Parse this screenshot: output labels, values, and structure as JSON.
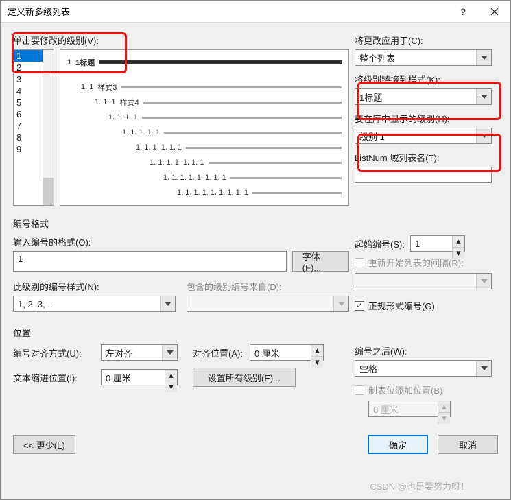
{
  "titlebar": {
    "title": "定义新多级列表"
  },
  "top": {
    "clickLevelLabel": "单击要修改的级别(V):",
    "levels": [
      "1",
      "2",
      "3",
      "4",
      "5",
      "6",
      "7",
      "8",
      "9"
    ],
    "selectedLevel": "1",
    "preview": [
      {
        "num": "1",
        "text": "1标题",
        "indent": 0,
        "bold": true,
        "thin": false
      },
      {
        "num": "1. 1",
        "text": "样式3",
        "indent": 20,
        "bold": false,
        "thin": true
      },
      {
        "num": "1. 1. 1",
        "text": "样式4",
        "indent": 40,
        "bold": false,
        "thin": true
      },
      {
        "num": "1. 1. 1. 1",
        "text": "",
        "indent": 60,
        "bold": false,
        "thin": true
      },
      {
        "num": "1. 1. 1. 1. 1",
        "text": "",
        "indent": 80,
        "bold": false,
        "thin": true
      },
      {
        "num": "1. 1. 1. 1. 1. 1",
        "text": "",
        "indent": 100,
        "bold": false,
        "thin": true
      },
      {
        "num": "1. 1. 1. 1. 1. 1. 1",
        "text": "",
        "indent": 120,
        "bold": false,
        "thin": true
      },
      {
        "num": "1. 1. 1. 1. 1. 1. 1. 1",
        "text": "",
        "indent": 140,
        "bold": false,
        "thin": true
      },
      {
        "num": "1. 1. 1. 1. 1. 1. 1. 1. 1",
        "text": "",
        "indent": 160,
        "bold": false,
        "thin": true
      }
    ]
  },
  "right": {
    "applyToLabel": "将更改应用于(C):",
    "applyToValue": "整个列表",
    "linkStyleLabel": "将级别链接到样式(K):",
    "linkStyleValue": "1标题",
    "showInGalleryLabel": "要在库中显示的级别(H):",
    "showInGalleryValue": "级别 1",
    "listNumLabel": "ListNum 域列表名(T):",
    "listNumValue": ""
  },
  "numberFormat": {
    "section": "编号格式",
    "enterFormatLabel": "输入编号的格式(O):",
    "enterFormatValue": "1",
    "fontBtn": "字体(F)...",
    "styleLabel": "此级别的编号样式(N):",
    "styleValue": "1, 2, 3, ...",
    "includeFromLabel": "包含的级别编号来自(D):",
    "includeFromValue": "",
    "startAtLabel": "起始编号(S):",
    "startAtValue": "1",
    "restartLabel": "重新开始列表的间隔(R):",
    "restartValue": "",
    "legalLabel": "正规形式编号(G)"
  },
  "position": {
    "section": "位置",
    "alignLabel": "编号对齐方式(U):",
    "alignValue": "左对齐",
    "alignAtLabel": "对齐位置(A):",
    "alignAtValue": "0 厘米",
    "indentLabel": "文本缩进位置(I):",
    "indentValue": "0 厘米",
    "setAllBtn": "设置所有级别(E)...",
    "followLabel": "编号之后(W):",
    "followValue": "空格",
    "tabAddLabel": "制表位添加位置(B):",
    "tabAddValue": "0 厘米"
  },
  "footer": {
    "less": "<< 更少(L)",
    "ok": "确定",
    "cancel": "取消"
  },
  "watermark": "CSDN @也是要努力呀！"
}
